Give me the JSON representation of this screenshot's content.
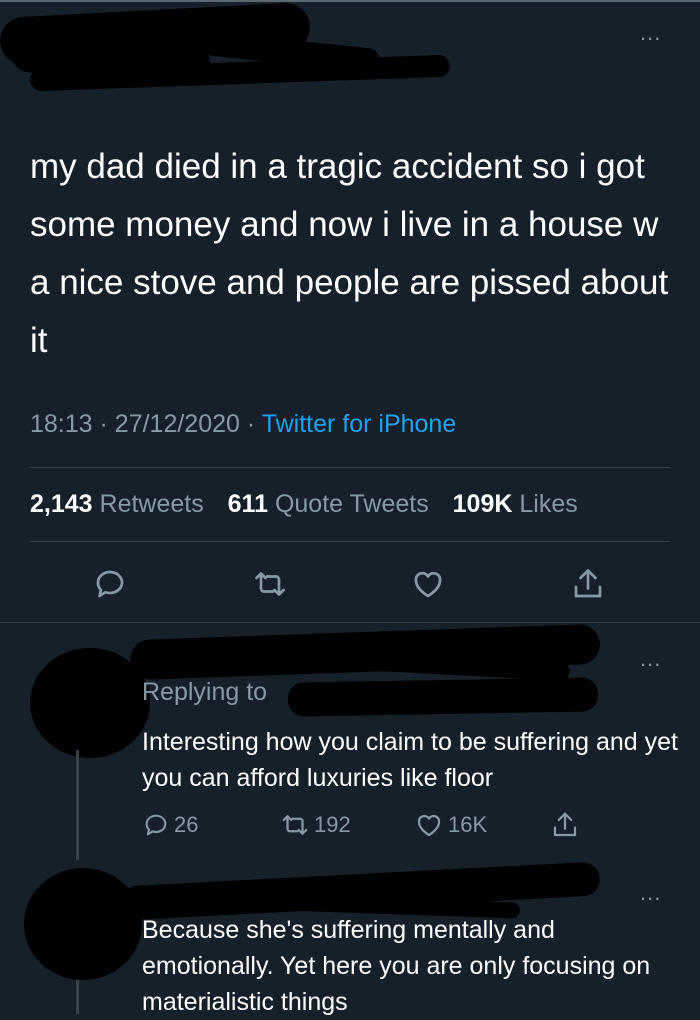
{
  "tweet": {
    "text": "my dad died in a tragic accident so i got some money and now i live in a house w a nice stove and people are pissed about it",
    "time": "18:13",
    "date": "27/12/2020",
    "source": "Twitter for iPhone",
    "retweets_count": "2,143",
    "retweets_label": "Retweets",
    "quotes_count": "611",
    "quotes_label": "Quote Tweets",
    "likes_count": "109K",
    "likes_label": "Likes",
    "more": "..."
  },
  "replies": [
    {
      "replying_label": "Replying to",
      "text": "Interesting how you claim to be suffering and yet you can afford luxuries like floor",
      "reply_count": "26",
      "retweet_count": "192",
      "like_count": "16K",
      "more": "..."
    },
    {
      "text": "Because she's suffering mentally and emotionally. Yet here you are only focusing on materialistic things",
      "more": "..."
    }
  ],
  "colors": {
    "background": "#15202b",
    "muted": "#8899a6",
    "link": "#1da1f2",
    "divider": "#38444d"
  },
  "icons": [
    "reply-icon",
    "retweet-icon",
    "like-icon",
    "share-icon"
  ]
}
